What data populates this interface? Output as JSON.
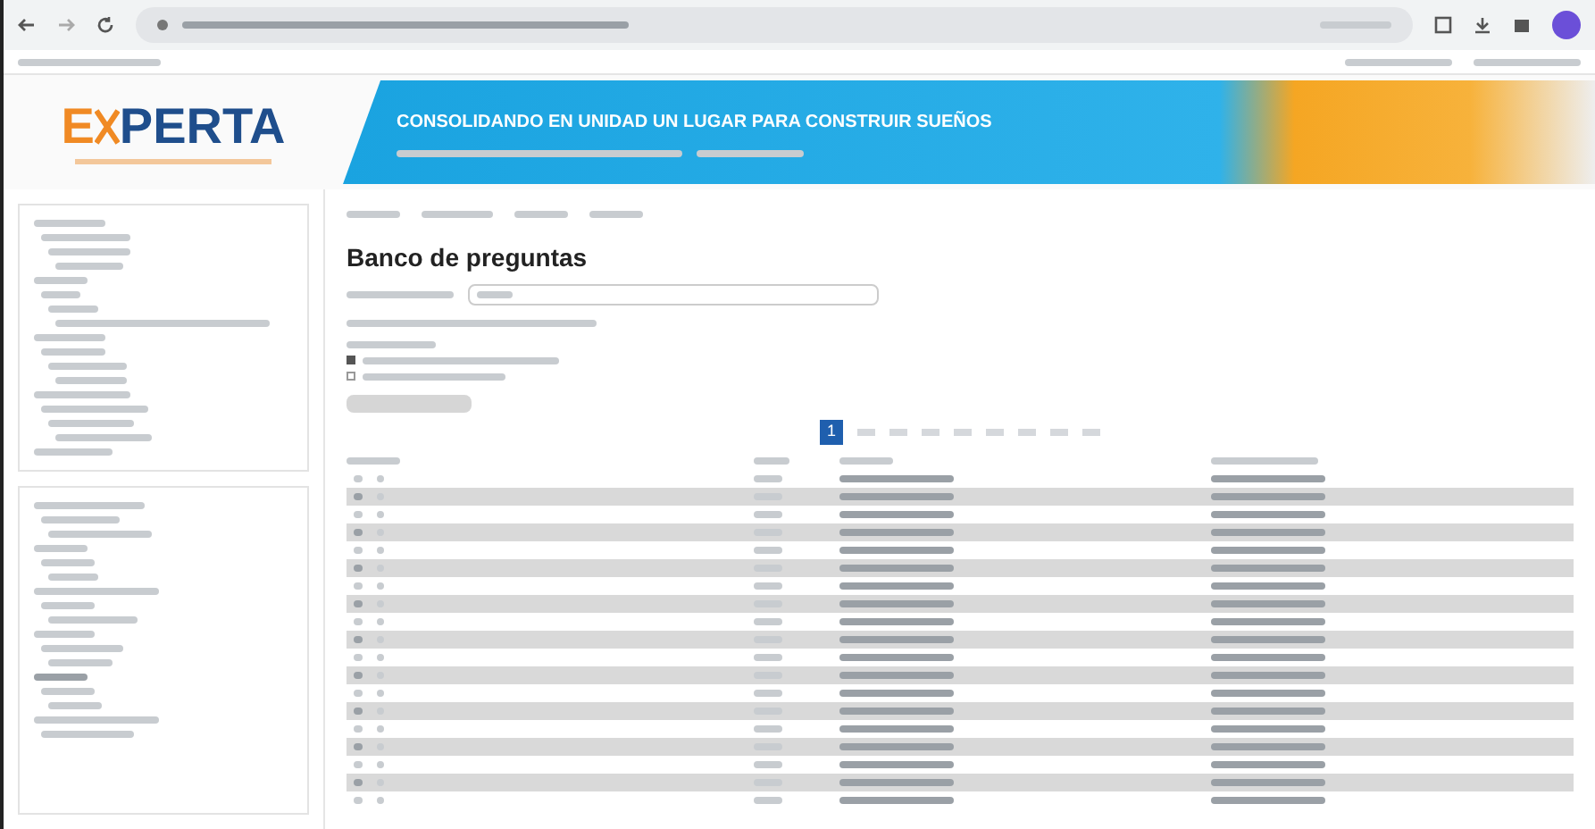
{
  "logo": {
    "first": "E",
    "rest": "PERTA"
  },
  "banner": {
    "title": "CONSOLIDANDO EN UNIDAD UN LUGAR PARA CONSTRUIR SUEÑOS"
  },
  "page": {
    "title": "Banco de preguntas"
  },
  "options": [
    {
      "checked": true
    },
    {
      "checked": false
    }
  ],
  "pagination": [
    {
      "label": "1",
      "selected": true
    },
    {
      "selected": false
    },
    {
      "selected": false
    },
    {
      "selected": false
    },
    {
      "selected": false
    },
    {
      "selected": false
    },
    {
      "selected": false
    },
    {
      "selected": false
    },
    {
      "selected": false
    }
  ],
  "rows": [
    {
      "shaded": false
    },
    {
      "shaded": true
    },
    {
      "shaded": false
    },
    {
      "shaded": true
    },
    {
      "shaded": false
    },
    {
      "shaded": true
    },
    {
      "shaded": false
    },
    {
      "shaded": true
    },
    {
      "shaded": false
    },
    {
      "shaded": true
    },
    {
      "shaded": false
    },
    {
      "shaded": true
    },
    {
      "shaded": false
    },
    {
      "shaded": true
    },
    {
      "shaded": false
    },
    {
      "shaded": true
    },
    {
      "shaded": false
    },
    {
      "shaded": true
    },
    {
      "shaded": false
    }
  ]
}
